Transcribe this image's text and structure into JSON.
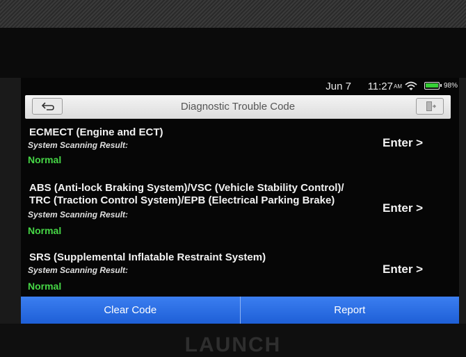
{
  "brand": "LAUNCH",
  "status_bar": {
    "date": "Jun 7",
    "time": "11:27",
    "ampm": "AM",
    "battery": "98%",
    "battery_color": "#36d036"
  },
  "header": {
    "title": "Diagnostic Trouble Code",
    "back_icon": "back-arrow-icon",
    "exit_icon": "exit-door-icon"
  },
  "systems": [
    {
      "name": "ECMECT (Engine and ECT)",
      "result_label": "System Scanning Result:",
      "status": "Normal",
      "action": "Enter >"
    },
    {
      "name": "ABS (Anti-lock Braking System)/VSC (Vehicle Stability Control)/ TRC (Traction Control System)/EPB (Electrical Parking Brake)",
      "result_label": "System Scanning Result:",
      "status": "Normal",
      "action": "Enter >"
    },
    {
      "name": "SRS (Supplemental Inflatable Restraint System)",
      "result_label": "System Scanning Result:",
      "status": "Normal",
      "action": "Enter >"
    }
  ],
  "footer": {
    "clear_code": "Clear Code",
    "report": "Report"
  },
  "colors": {
    "status_normal": "#46d646",
    "button_blue": "#1e5fd6"
  }
}
